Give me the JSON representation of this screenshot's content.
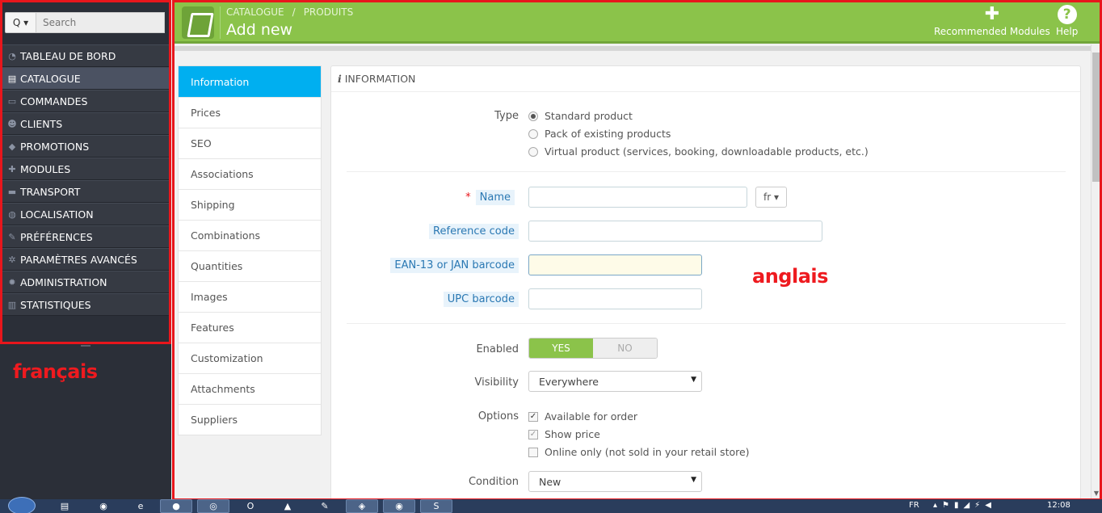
{
  "sidebar": {
    "search_label": "Q",
    "search_placeholder": "Search",
    "items": [
      {
        "label": "TABLEAU DE BORD",
        "icon": "dashboard-icon"
      },
      {
        "label": "CATALOGUE",
        "icon": "book-icon"
      },
      {
        "label": "COMMANDES",
        "icon": "credit-card-icon"
      },
      {
        "label": "CLIENTS",
        "icon": "users-icon"
      },
      {
        "label": "PROMOTIONS",
        "icon": "tags-icon"
      },
      {
        "label": "MODULES",
        "icon": "puzzle-icon"
      },
      {
        "label": "TRANSPORT",
        "icon": "truck-icon"
      },
      {
        "label": "LOCALISATION",
        "icon": "globe-icon"
      },
      {
        "label": "PRÉFÉRENCES",
        "icon": "wrench-icon"
      },
      {
        "label": "PARAMÈTRES AVANCÉS",
        "icon": "cogs-icon"
      },
      {
        "label": "ADMINISTRATION",
        "icon": "gear-icon"
      },
      {
        "label": "STATISTIQUES",
        "icon": "bar-chart-icon"
      }
    ],
    "active_index": 1
  },
  "annotations": {
    "left_label": "français",
    "right_label": "anglais",
    "color": "#ee1a1f"
  },
  "header": {
    "breadcrumb": [
      "CATALOGUE",
      "/",
      "PRODUITS"
    ],
    "title": "Add new",
    "recommended_modules": "Recommended Modules",
    "help": "Help",
    "help_glyph": "?",
    "color": "#8bc34a"
  },
  "tabs": [
    "Information",
    "Prices",
    "SEO",
    "Associations",
    "Shipping",
    "Combinations",
    "Quantities",
    "Images",
    "Features",
    "Customization",
    "Attachments",
    "Suppliers"
  ],
  "active_tab": 0,
  "panel": {
    "heading_icon": "i",
    "heading": "INFORMATION",
    "type_label": "Type",
    "type_options": [
      {
        "label": "Standard product",
        "checked": true
      },
      {
        "label": "Pack of existing products",
        "checked": false
      },
      {
        "label": "Virtual product (services, booking, downloadable products, etc.)",
        "checked": false
      }
    ],
    "required_mark": "*",
    "name_label": "Name",
    "name_value": "",
    "lang": "fr",
    "reference_label": "Reference code",
    "reference_value": "",
    "ean_label": "EAN-13 or JAN barcode",
    "ean_value": "",
    "upc_label": "UPC barcode",
    "upc_value": "",
    "enabled_label": "Enabled",
    "yes": "YES",
    "no": "NO",
    "visibility_label": "Visibility",
    "visibility_value": "Everywhere",
    "options_label": "Options",
    "options": [
      {
        "label": "Available for order",
        "checked": true
      },
      {
        "label": "Show price",
        "checked": true
      },
      {
        "label": "Online only (not sold in your retail store)",
        "checked": false
      }
    ],
    "condition_label": "Condition",
    "condition_value": "New"
  },
  "taskbar": {
    "lang": "FR",
    "clock": "12:08"
  }
}
